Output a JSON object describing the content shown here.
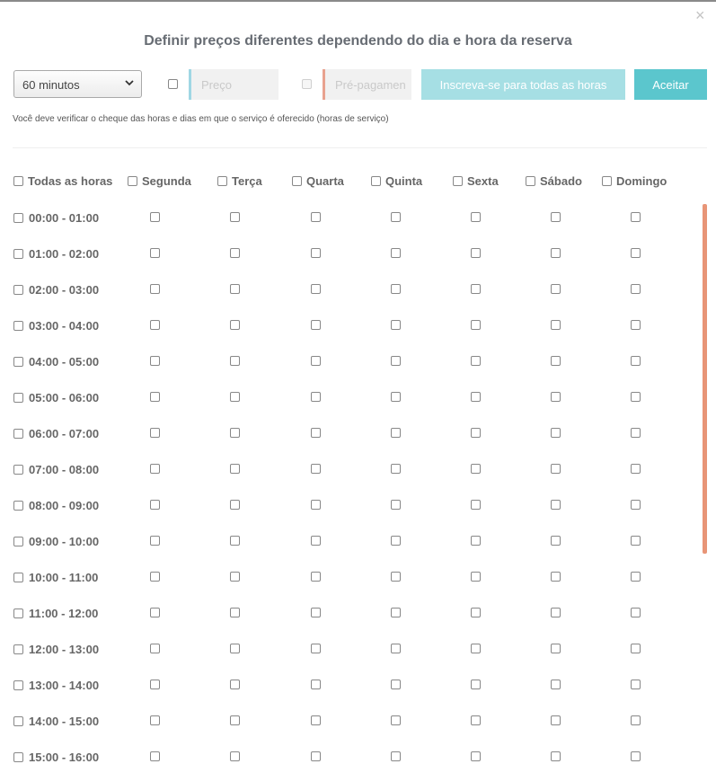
{
  "dialog": {
    "title": "Definir preços diferentes dependendo do dia e hora da reserva",
    "close_symbol": "×"
  },
  "controls": {
    "duration_selected": "60 minutos",
    "price_placeholder": "Preço",
    "prepayment_placeholder": "Pré-pagamen",
    "apply_all_label": "Inscreva-se para todas as horas",
    "accept_label": "Aceitar"
  },
  "note": "Você deve verificar o cheque das horas e dias em que o serviço é oferecido (horas de serviço)",
  "grid": {
    "all_hours_label": "Todas as horas",
    "days": [
      "Segunda",
      "Terça",
      "Quarta",
      "Quinta",
      "Sexta",
      "Sábado",
      "Domingo"
    ],
    "hours": [
      "00:00 - 01:00",
      "01:00 - 02:00",
      "02:00 - 03:00",
      "03:00 - 04:00",
      "04:00 - 05:00",
      "05:00 - 06:00",
      "06:00 - 07:00",
      "07:00 - 08:00",
      "08:00 - 09:00",
      "09:00 - 10:00",
      "10:00 - 11:00",
      "11:00 - 12:00",
      "12:00 - 13:00",
      "13:00 - 14:00",
      "14:00 - 15:00",
      "15:00 - 16:00"
    ]
  },
  "colors": {
    "accent": "#5bc6cd",
    "accent_light": "#a6dfe4",
    "price_border": "#9fd7e4",
    "prepay_border": "#e8a28f",
    "scrollbar": "#e89577"
  }
}
